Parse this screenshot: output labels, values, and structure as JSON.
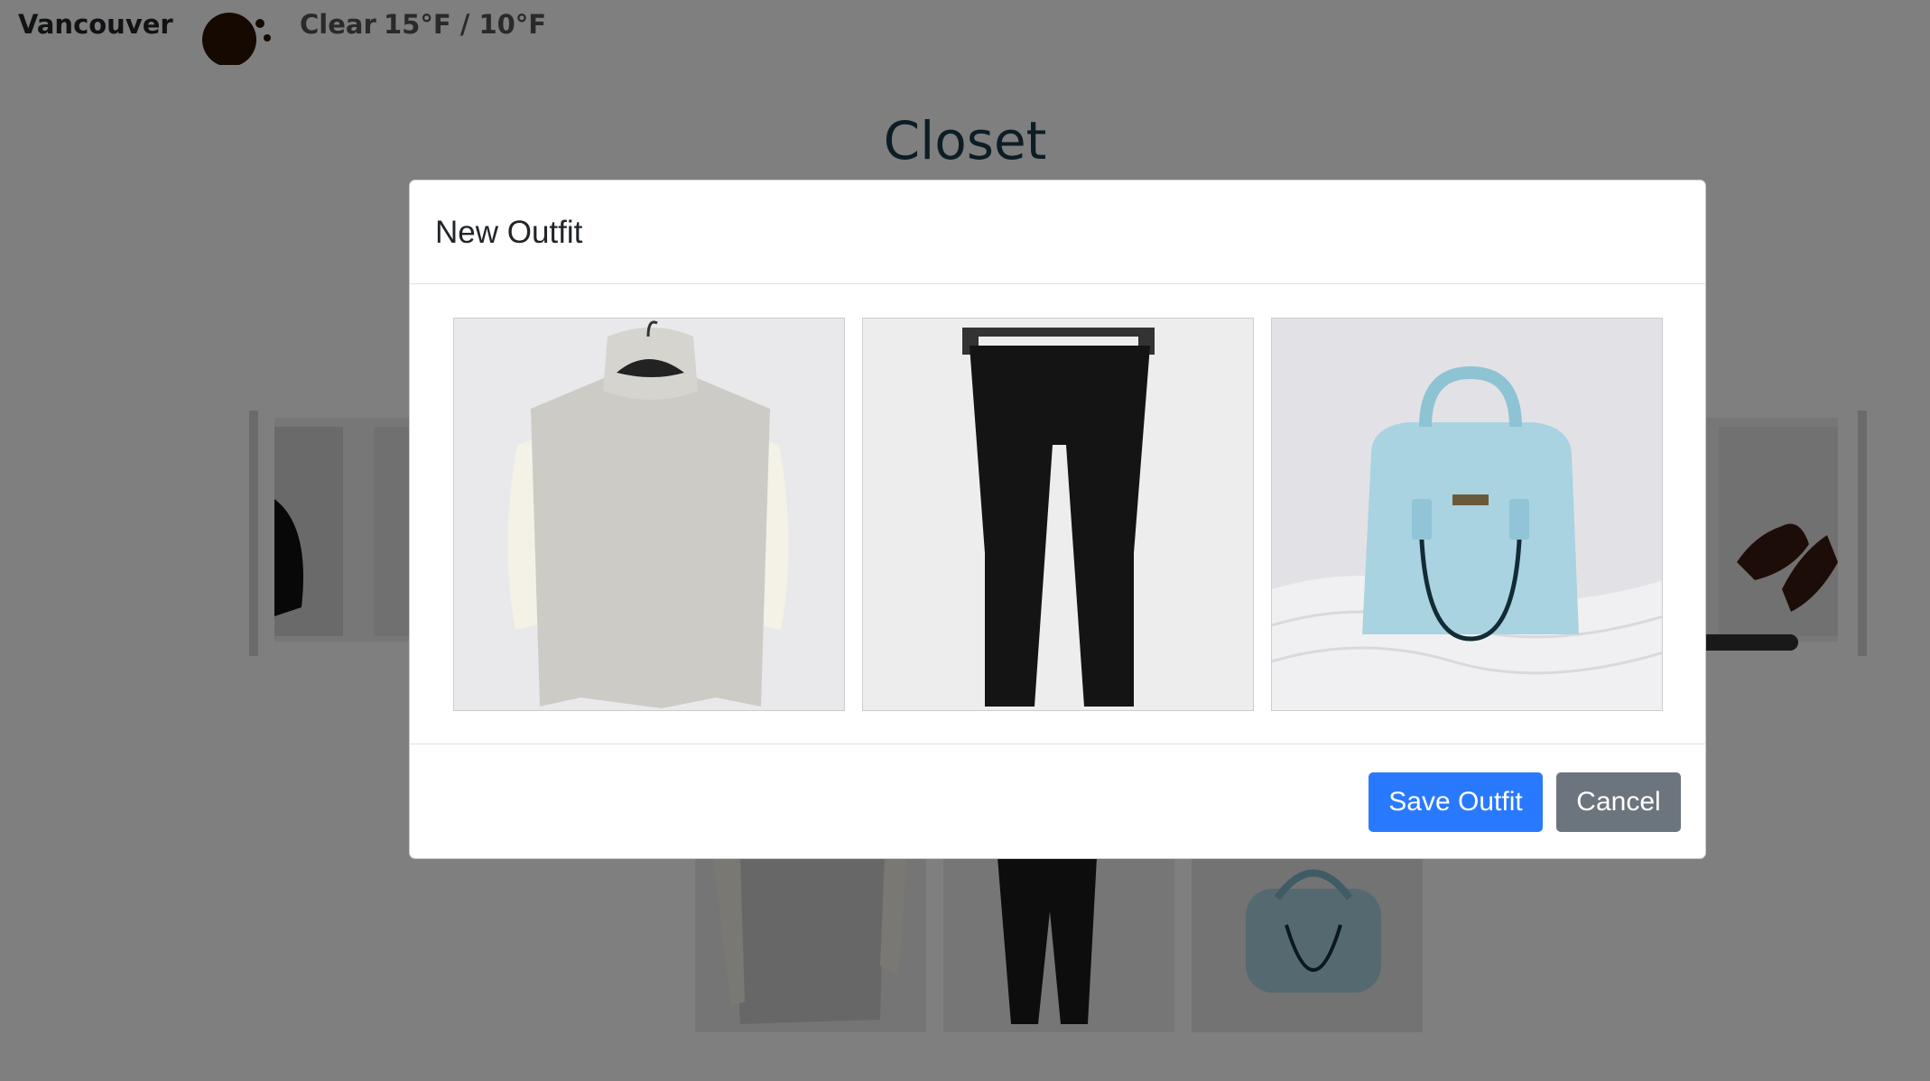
{
  "header": {
    "city": "Vancouver",
    "weather_icon": "moon-clouds-icon",
    "condition": "Clear",
    "temperature": "15°F / 10°F"
  },
  "page": {
    "title": "Closet"
  },
  "modal": {
    "title": "New Outfit",
    "items": [
      {
        "icon": "sweater-image",
        "colors": {
          "body": "#cfcfcf",
          "sleeves": "#f4f1e6"
        }
      },
      {
        "icon": "pants-image",
        "colors": {
          "body": "#1a1a1a"
        }
      },
      {
        "icon": "handbag-image",
        "colors": {
          "body": "#a9d3e0"
        }
      }
    ],
    "save_label": "Save Outfit",
    "cancel_label": "Cancel"
  },
  "colors": {
    "primary": "#2979ff",
    "secondary": "#6c757d",
    "title": "#1b3a4b"
  }
}
